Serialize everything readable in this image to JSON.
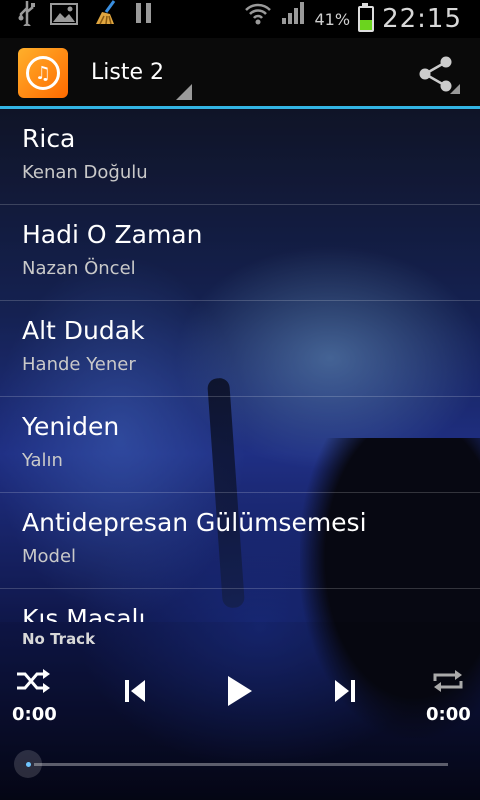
{
  "status_bar": {
    "battery_percent": "41%",
    "time": "22:15",
    "icons": [
      "usb-icon",
      "image-icon",
      "broom-icon",
      "pause-icon",
      "wifi-icon",
      "signal-icon",
      "battery-charging-icon"
    ]
  },
  "action_bar": {
    "title": "Liste 2",
    "accent_color": "#33b5e5",
    "icons": [
      "music-app-icon",
      "share-icon"
    ]
  },
  "tracks": [
    {
      "title": "Rica",
      "artist": "Kenan Doğulu"
    },
    {
      "title": "Hadi O Zaman",
      "artist": "Nazan Öncel"
    },
    {
      "title": "Alt Dudak",
      "artist": "Hande Yener"
    },
    {
      "title": "Yeniden",
      "artist": "Yalın"
    },
    {
      "title": "Antidepresan Gülümsemesi",
      "artist": "Model"
    },
    {
      "title": "Kış Masalı",
      "artist": ""
    }
  ],
  "player": {
    "now_playing": "No Track",
    "elapsed": "0:00",
    "duration": "0:00",
    "progress": 0,
    "icons": [
      "shuffle-icon",
      "previous-icon",
      "play-icon",
      "next-icon",
      "repeat-icon"
    ]
  }
}
